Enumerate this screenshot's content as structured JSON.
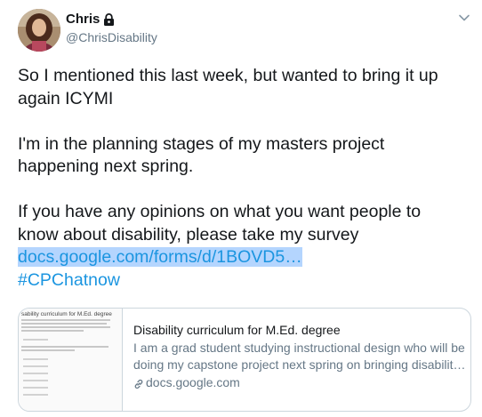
{
  "author": {
    "display_name": "Chris",
    "handle": "@ChrisDisability"
  },
  "tweet": {
    "line1": "So I mentioned this last week, but wanted to bring it up",
    "line2": "again ICYMI",
    "line3": "I'm in the planning stages of my masters project",
    "line4": "happening next spring.",
    "line5": "If you have any opinions on what you want people to",
    "line6": "know about disability, please take my survey",
    "link_text": "docs.google.com/forms/d/1BOVD5…",
    "hashtag": "#CPChatnow"
  },
  "card": {
    "title": "Disability curriculum for M.Ed. degree",
    "desc_line1": "I am a grad student studying instructional design who will be",
    "desc_line2": "doing my capstone project next spring on bringing disabilit…",
    "domain": "docs.google.com",
    "thumbnail_title": "sability curriculum for M.Ed. degree"
  },
  "colors": {
    "link": "#1b95e0",
    "selection": "#b4d5fe",
    "secondary_text": "#657786",
    "border": "#ccd6dd"
  },
  "icons": {
    "lock": "lock-icon",
    "caret": "chevron-down-icon",
    "link": "link-icon"
  }
}
